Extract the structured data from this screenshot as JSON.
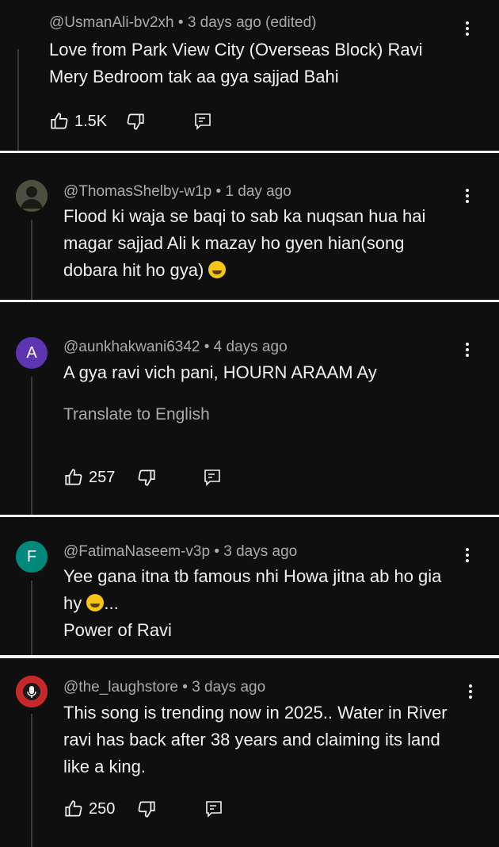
{
  "comments": [
    {
      "meta": "@UsmanAli-bv2xh • 3 days ago (edited)",
      "lines": [
        "Love from Park View City (Overseas Block)  Ravi",
        "Mery Bedroom tak aa gya sajjad Bahi"
      ],
      "likes": "1.5K"
    },
    {
      "meta": "@ThomasShelby-w1p • 1 day ago",
      "lines": [
        "Flood ki waja se baqi to sab ka nuqsan hua hai",
        "magar sajjad Ali k mazay ho gyen hian(song",
        "dobara hit ho gya)"
      ],
      "avatar_color": "#5a5a4a"
    },
    {
      "meta": "@aunkhakwani6342 • 4 days ago",
      "lines": [
        "A gya ravi vich pani, HOURN ARAAM Ay"
      ],
      "translate": "Translate to English",
      "likes": "257",
      "avatar_letter": "A",
      "avatar_color": "#5e35b1"
    },
    {
      "meta": "@FatimaNaseem-v3p • 3 days ago",
      "lines": [
        "Yee gana itna tb famous nhi Howa jitna ab ho gia",
        "hy",
        "...",
        "Power of Ravi"
      ],
      "avatar_letter": "F",
      "avatar_color": "#00897b"
    },
    {
      "meta": "@the_laughstore • 3 days ago",
      "lines": [
        "This song is trending now in 2025.. Water in River",
        "ravi has back after 38 years and claiming its land",
        "like a king."
      ],
      "likes": "250",
      "avatar_color": "#c62828",
      "avatar_label": "THE LAUGH STORE"
    }
  ],
  "colors": {
    "background": "#0f0f0f",
    "text": "#f1f1f1",
    "meta": "#aaaaaa",
    "divider": "#f1f1f1"
  }
}
